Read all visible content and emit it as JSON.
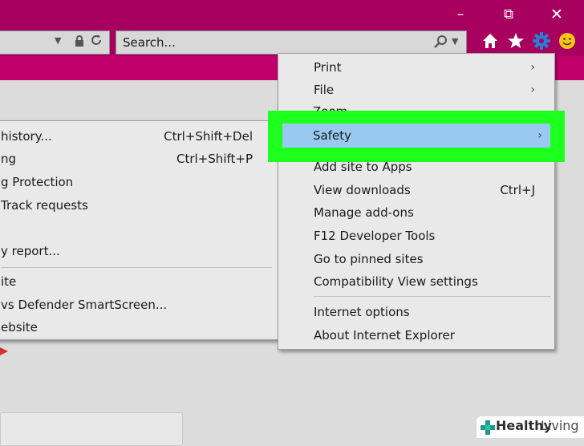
{
  "window": {
    "minimize_glyph": "–",
    "restore_glyph": "⧉",
    "close_glyph": "✕"
  },
  "toolbar": {
    "search_placeholder": "Search...",
    "icons": [
      "home-icon",
      "favorites-star-icon",
      "tools-gear-icon",
      "feedback-smiley-icon"
    ]
  },
  "colors": {
    "titlebar": "#a8005f",
    "tabstrip": "#c2006b",
    "highlight_outline": "#1dff1d",
    "selected_item": "#99c9f0"
  },
  "safety_submenu": {
    "items": [
      {
        "label": "history...",
        "shortcut": "Ctrl+Shift+Del"
      },
      {
        "label": "ng",
        "shortcut": "Ctrl+Shift+P"
      },
      {
        "label": "g Protection",
        "shortcut": ""
      },
      {
        "label": "Track requests",
        "shortcut": ""
      },
      {
        "label": "y report...",
        "shortcut": ""
      },
      {
        "label": "ite",
        "shortcut": ""
      },
      {
        "label": "vs Defender SmartScreen...",
        "shortcut": ""
      },
      {
        "label": "ebsite",
        "shortcut": ""
      }
    ]
  },
  "tools_menu": {
    "items": [
      {
        "label": "Print",
        "shortcut": "",
        "submenu": true
      },
      {
        "label": "File",
        "shortcut": "",
        "submenu": true
      },
      {
        "label": "Zoom (100%)",
        "shortcut": "",
        "submenu": true,
        "partially_hidden": true
      },
      {
        "label": "Safety",
        "shortcut": "",
        "submenu": true,
        "selected": true
      },
      {
        "label": "Add site to Apps",
        "shortcut": ""
      },
      {
        "label": "View downloads",
        "shortcut": "Ctrl+J"
      },
      {
        "label": "Manage add-ons",
        "shortcut": ""
      },
      {
        "label": "F12 Developer Tools",
        "shortcut": ""
      },
      {
        "label": "Go to pinned sites",
        "shortcut": ""
      },
      {
        "label": "Compatibility View settings",
        "shortcut": ""
      },
      {
        "label": "Internet options",
        "shortcut": ""
      },
      {
        "label": "About Internet Explorer",
        "shortcut": ""
      }
    ],
    "submenu_arrow": "›"
  },
  "watermark": {
    "brand_bold": "Healthy",
    "brand_light": "Living"
  }
}
